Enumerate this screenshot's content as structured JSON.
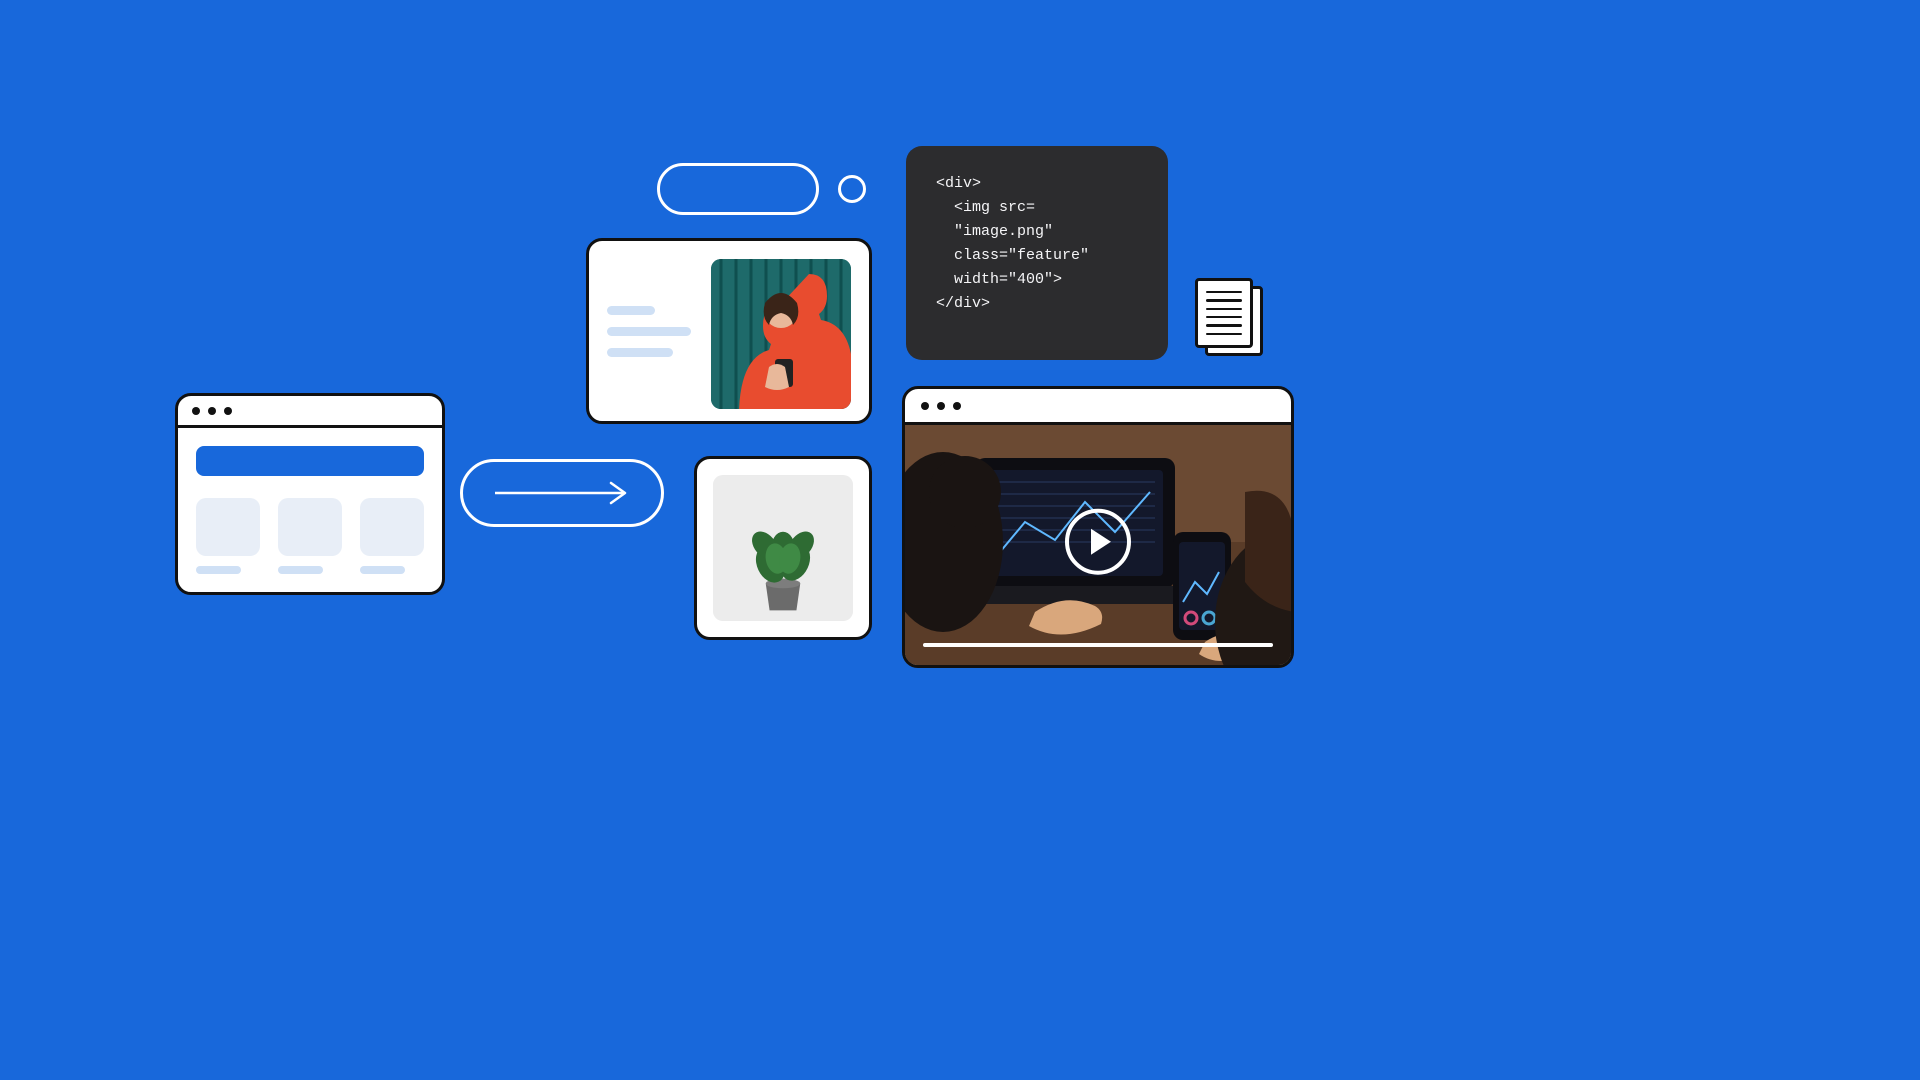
{
  "code_snippet": {
    "line1": "<div>",
    "line2": "<img src=",
    "line3": "\"image.png\"",
    "line4": "class=\"feature\"",
    "line5": "width=\"400\">",
    "line6": "</div>"
  },
  "colors": {
    "background": "#1868DB",
    "code_bg": "#2C2C2E",
    "card_border": "#111111",
    "card_bg": "#FFFFFF",
    "skeleton": "#CFE0F5"
  },
  "icons": {
    "arrow": "arrow-right-icon",
    "play": "play-icon",
    "document": "document-stack-icon"
  }
}
